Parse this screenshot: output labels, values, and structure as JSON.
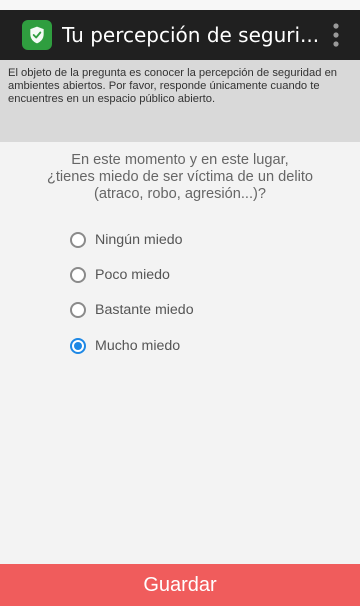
{
  "app": {
    "title": "Tu percepción de seguri...",
    "icon": "shield-icon",
    "overflow_icon": "vertical-ellipsis-icon"
  },
  "notice": {
    "text": "El objeto de la pregunta es conocer la percepción de seguridad en ambientes abiertos. Por favor, responde únicamente cuando te encuentres en un espacio público abierto."
  },
  "question": {
    "line1": "En este momento y en este lugar,",
    "line2": "¿tienes miedo de ser víctima de un delito",
    "line3": "(atraco, robo, agresión...)?"
  },
  "options": [
    {
      "label": "Ningún miedo",
      "selected": false
    },
    {
      "label": "Poco miedo",
      "selected": false
    },
    {
      "label": "Bastante miedo",
      "selected": false
    },
    {
      "label": "Mucho miedo",
      "selected": true
    }
  ],
  "footer": {
    "save_label": "Guardar"
  },
  "colors": {
    "toolbar": "#202020",
    "app_icon": "#2f9e3f",
    "selected_radio": "#1e88e5",
    "save_button": "#f05c5c"
  }
}
